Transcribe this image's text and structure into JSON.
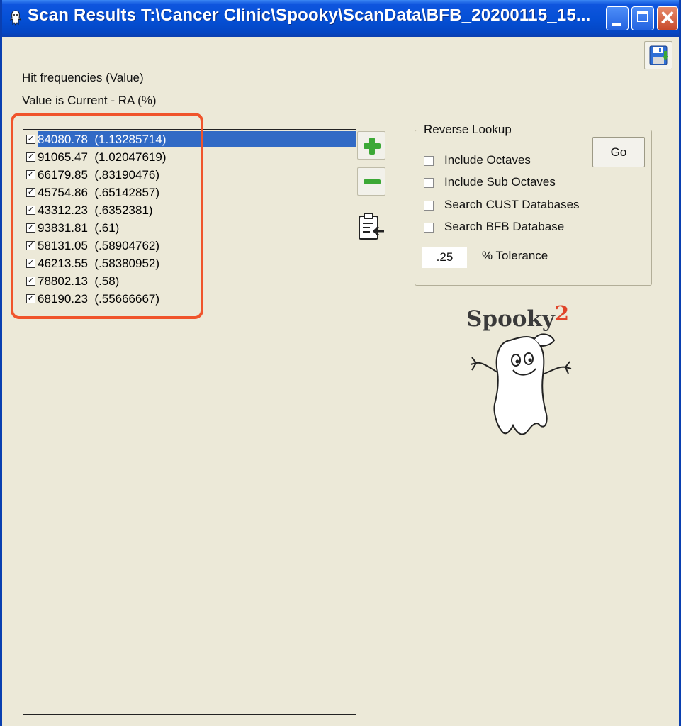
{
  "window": {
    "title": "Scan Results T:\\Cancer Clinic\\Spooky\\ScanData\\BFB_20200115_15..."
  },
  "labels": {
    "hit_frequencies": "Hit frequencies (Value)",
    "value_description": "Value is Current - RA (%)"
  },
  "hits": [
    {
      "text": "84080.78  (1.13285714)",
      "checked": true,
      "selected": true
    },
    {
      "text": "91065.47  (1.02047619)",
      "checked": true
    },
    {
      "text": "66179.85  (.83190476)",
      "checked": true
    },
    {
      "text": "45754.86  (.65142857)",
      "checked": true
    },
    {
      "text": "43312.23  (.6352381)",
      "checked": true
    },
    {
      "text": "93831.81  (.61)",
      "checked": true
    },
    {
      "text": "58131.05  (.58904762)",
      "checked": true
    },
    {
      "text": "46213.55  (.58380952)",
      "checked": true
    },
    {
      "text": "78802.13  (.58)",
      "checked": true
    },
    {
      "text": "68190.23  (.55666667)",
      "checked": true
    }
  ],
  "reverse_lookup": {
    "title": "Reverse Lookup",
    "go_label": "Go",
    "options": [
      {
        "label": "Include Octaves",
        "checked": false
      },
      {
        "label": "Include Sub Octaves",
        "checked": false
      },
      {
        "label": "Search CUST Databases",
        "checked": false
      },
      {
        "label": "Search BFB Database",
        "checked": false
      }
    ],
    "tolerance_value": ".25",
    "tolerance_label": "% Tolerance"
  },
  "logo": {
    "text": "Spooky",
    "superscript": "2"
  },
  "icons": {
    "save": "save-floppy-icon",
    "add": "plus-icon",
    "remove": "minus-icon",
    "paste": "clipboard-paste-icon"
  },
  "colors": {
    "selection": "#316ac5",
    "highlight_border": "#f0542b",
    "plus_minus": "#3ca836",
    "titlebar": "#0550d6"
  }
}
